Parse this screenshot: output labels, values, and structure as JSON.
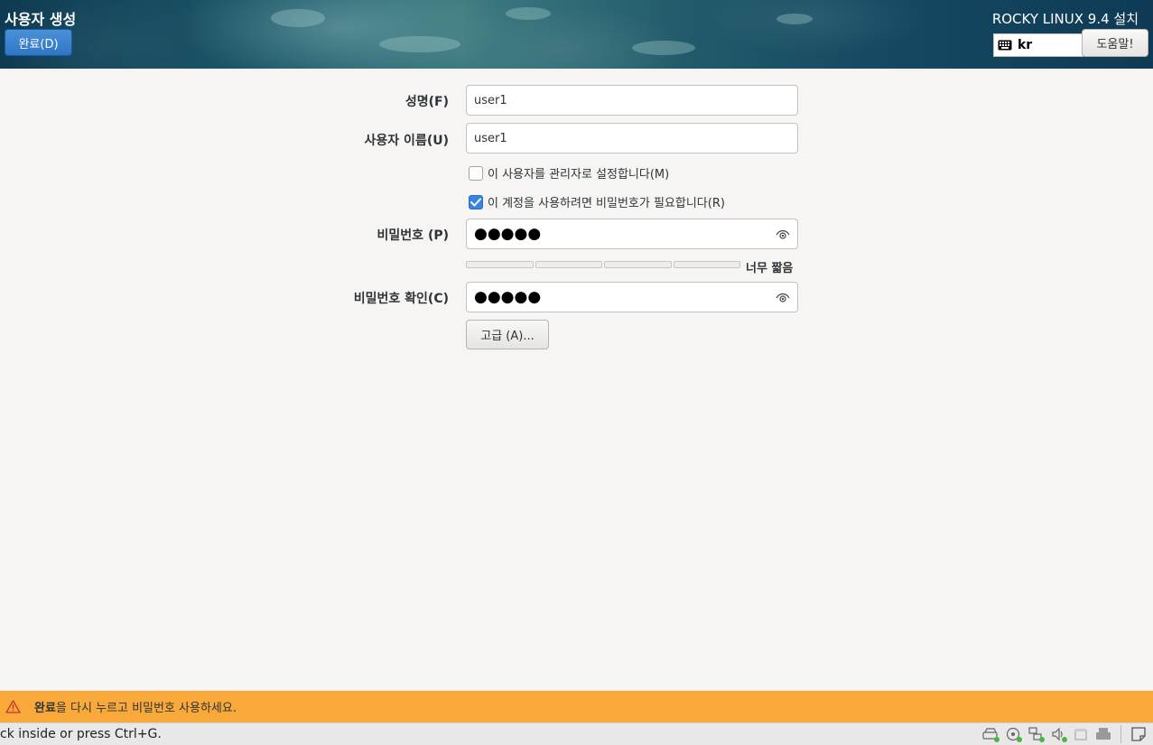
{
  "header": {
    "page_title": "사용자 생성",
    "done_label": "완료(D)",
    "product_title": "ROCKY LINUX 9.4 설치",
    "keyboard_layout": "kr",
    "help_label": "도움말!"
  },
  "form": {
    "fullname_label": "성명(F)",
    "fullname_value": "user1",
    "username_label": "사용자 이름(U)",
    "username_value": "user1",
    "admin_checkbox": {
      "label": "이 사용자를 관리자로 설정합니다(M)",
      "checked": false
    },
    "require_password_checkbox": {
      "label": "이 계정을 사용하려면 비밀번호가 필요합니다(R)",
      "checked": true
    },
    "password_label": "비밀번호 (P)",
    "password_mask": "●●●●●",
    "strength_text": "너무 짧음",
    "strength_level": 0,
    "confirm_label": "비밀번호 확인(C)",
    "confirm_mask": "●●●●●",
    "advanced_label": "고급 (A)..."
  },
  "warning": {
    "bold_part": "완료",
    "rest": "을 다시 누르고 비밀번호 사용하세요."
  },
  "status_bar": {
    "hint_text": "ck inside or press Ctrl+G."
  },
  "colors": {
    "accent": "#3584e4",
    "warning": "#f9a93a",
    "background": "#f6f5f4"
  }
}
